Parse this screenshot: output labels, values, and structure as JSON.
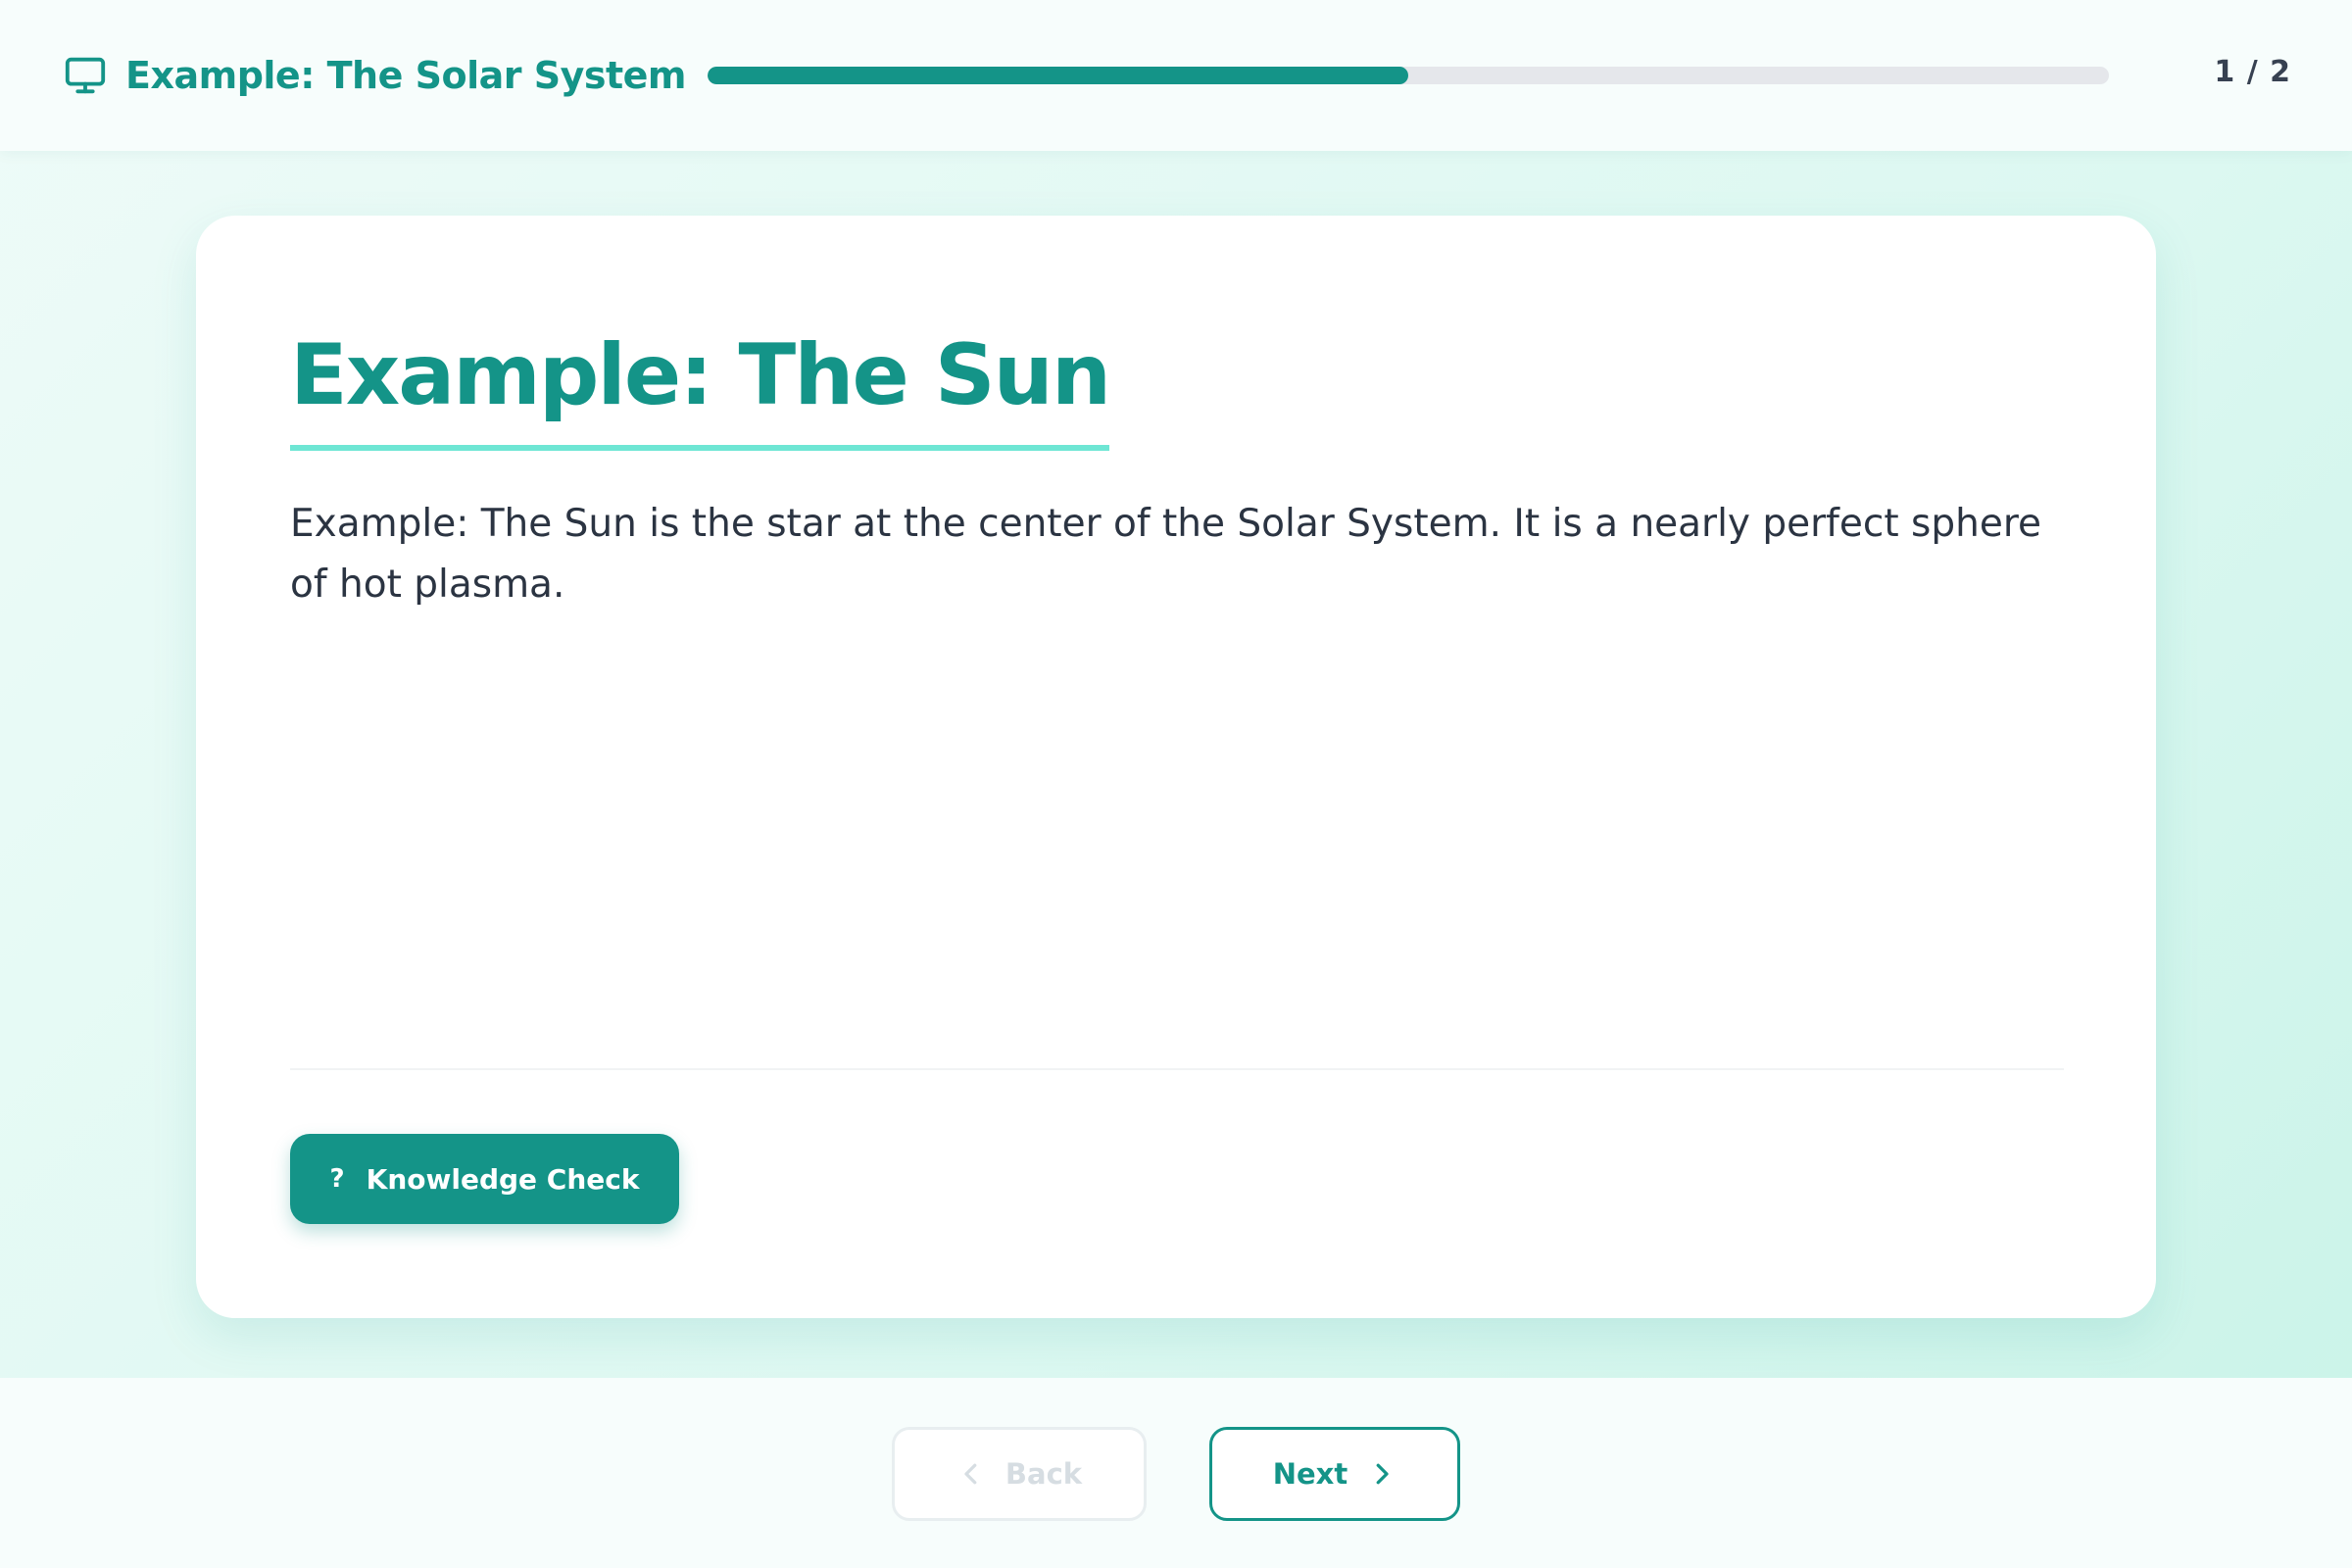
{
  "header": {
    "course_title": "Example: The Solar System",
    "icon": "monitor-icon",
    "progress": 0.5,
    "slide_counter": "1 / 2"
  },
  "slide": {
    "title": "Example: The Sun",
    "body": "Example: The Sun is the star at the center of the Solar System. It is a nearly perfect sphere of hot plasma.",
    "knowledge_check": {
      "label": "Knowledge Check",
      "icon_glyph": "?"
    }
  },
  "navigation": {
    "back_label": "Back",
    "back_disabled": true,
    "next_label": "Next"
  },
  "colors": {
    "accent": "#149488",
    "accent_light": "#6ee6d4",
    "text": "#2b3442",
    "disabled": "#d6dde2"
  }
}
